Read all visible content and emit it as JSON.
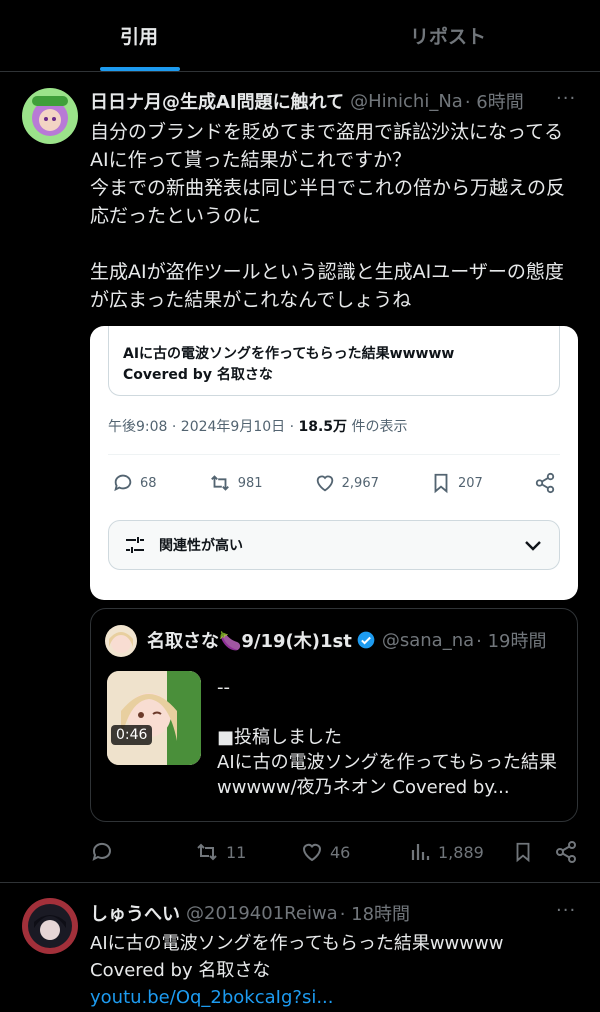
{
  "tabs": {
    "quote": "引用",
    "repost": "リポスト"
  },
  "post1": {
    "name": "日日ナ月@生成AI問題に触れて",
    "handle": "@Hinichi_Na",
    "time": "· 6時間",
    "text": "自分のブランドを貶めてまで盗用で訴訟沙汰になってるAIに作って貰った結果がこれですか？\n今までの新曲発表は同じ半日でこれの倍から万越えの反応だったというのに\n\n生成AIが盗作ツールという認識と生成AIユーザーの態度が広まった結果がこれなんでしょうね",
    "screenshot": {
      "embedded_title": "AIに古の電波ソングを作ってもらった結果wwwww\nCovered by 名取さな",
      "timestamp": "午後9:08 · 2024年9月10日 · ",
      "views_num": "18.5万",
      "views_label": " 件の表示",
      "replies": "68",
      "reposts": "981",
      "likes": "2,967",
      "bookmarks": "207",
      "filter_label": "関連性が高い"
    },
    "quoted": {
      "name": "名取さな🍆9/19(木)1st",
      "handle": "@sana_na",
      "time": "· 19時間",
      "video_duration": "0:46",
      "text": "--\n\n■投稿しました\nAIに古の電波ソングを作ってもらった結果wwwww/夜乃ネオン Covered by..."
    },
    "stats": {
      "reposts": "11",
      "likes": "46",
      "views": "1,889"
    }
  },
  "post2": {
    "name": "しゅうへい",
    "handle": "@2019401Reiwa",
    "time": "· 18時間",
    "text": "AIに古の電波ソングを作ってもらった結果wwwww\nCovered by 名取さな",
    "link": "youtu.be/Oq_2bokcaIg?si..."
  },
  "colors": {
    "accent": "#1d9bf0",
    "muted": "#71767b",
    "verified": "#1d9bf0"
  }
}
